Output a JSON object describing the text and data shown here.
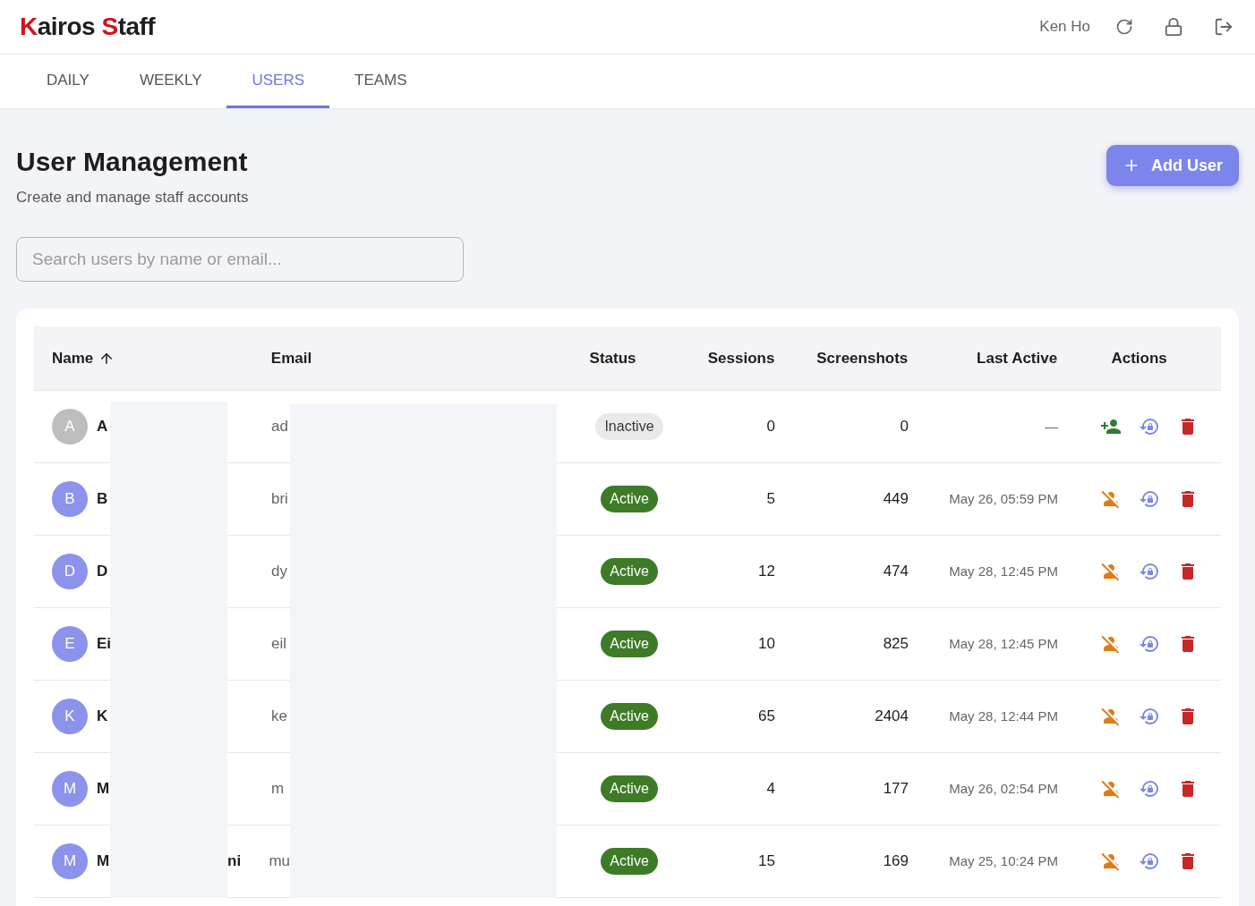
{
  "brand": {
    "first_initial": "K",
    "first_rest": "airos ",
    "second_initial": "S",
    "second_rest": "taff"
  },
  "user": {
    "name": "Ken Ho"
  },
  "tabs": [
    {
      "label": "DAILY",
      "selected": false
    },
    {
      "label": "WEEKLY",
      "selected": false
    },
    {
      "label": "USERS",
      "selected": true
    },
    {
      "label": "TEAMS",
      "selected": false
    }
  ],
  "page": {
    "title": "User Management",
    "subtitle": "Create and manage staff accounts",
    "add_button": "Add User"
  },
  "search": {
    "placeholder": "Search users by name or email..."
  },
  "table": {
    "columns": [
      "Name",
      "Email",
      "Status",
      "Sessions",
      "Screenshots",
      "Last Active",
      "Actions"
    ],
    "rows": [
      {
        "initial": "A",
        "color": "#bdbdbd",
        "name": "A",
        "email": "ad",
        "status": "Inactive",
        "kind": "inactive",
        "sessions": "0",
        "screenshots": "0",
        "last_active": "—"
      },
      {
        "initial": "B",
        "color": "#8c93ec",
        "name": "B",
        "email": "bri",
        "status": "Active",
        "kind": "active",
        "sessions": "5",
        "screenshots": "449",
        "last_active": "May 26, 05:59 PM"
      },
      {
        "initial": "D",
        "color": "#8c93ec",
        "name": "D",
        "email": "dy",
        "status": "Active",
        "kind": "active",
        "sessions": "12",
        "screenshots": "474",
        "last_active": "May 28, 12:45 PM"
      },
      {
        "initial": "E",
        "color": "#8c93ec",
        "name": "Ei",
        "email": "eil",
        "status": "Active",
        "kind": "active",
        "sessions": "10",
        "screenshots": "825",
        "last_active": "May 28, 12:45 PM"
      },
      {
        "initial": "K",
        "color": "#8c93ec",
        "name": "K",
        "email": "ke",
        "status": "Active",
        "kind": "active",
        "sessions": "65",
        "screenshots": "2404",
        "last_active": "May 28, 12:44 PM"
      },
      {
        "initial": "M",
        "color": "#8c93ec",
        "name": "M",
        "email": "m",
        "status": "Active",
        "kind": "active",
        "sessions": "4",
        "screenshots": "177",
        "last_active": "May 26, 02:54 PM"
      },
      {
        "initial": "M",
        "color": "#8c93ec",
        "name": "M",
        "name_end": "ni",
        "email": "mu",
        "status": "Active",
        "kind": "active",
        "sessions": "15",
        "screenshots": "169",
        "last_active": "May 25, 10:24 PM"
      }
    ]
  }
}
